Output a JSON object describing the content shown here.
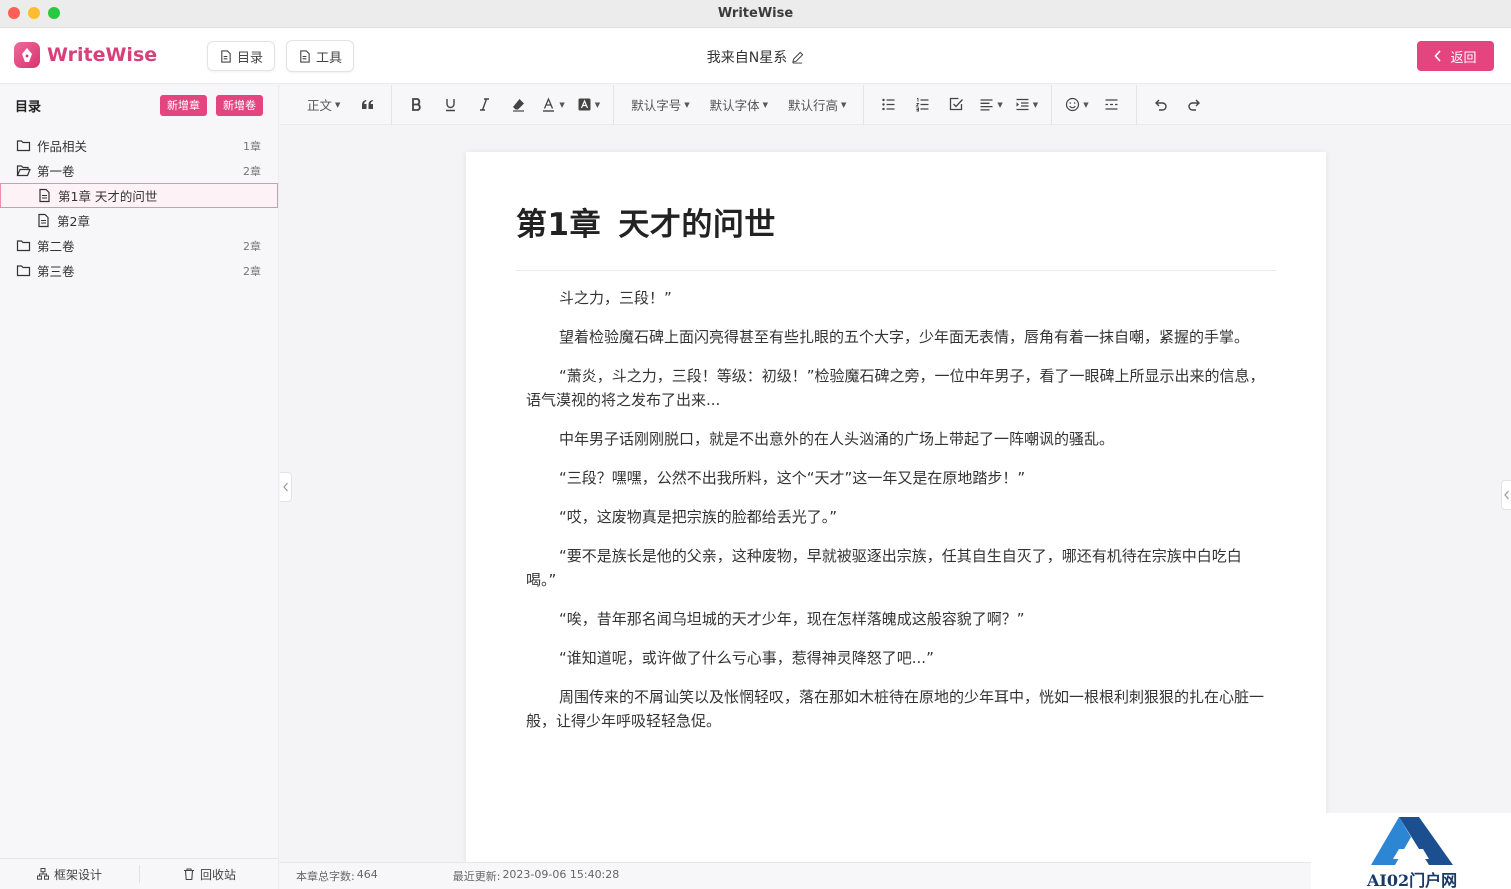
{
  "window": {
    "title": "WriteWise"
  },
  "header": {
    "logo_text": "WriteWise",
    "catalog_btn": "目录",
    "tools_btn": "工具",
    "doc_title": "我来自N星系",
    "back_btn": "返回",
    "accent": "#e5457f"
  },
  "sidebar": {
    "title": "目录",
    "new_chapter": "新增章",
    "new_volume": "新增卷",
    "items": [
      {
        "label": "作品相关",
        "count": "1章",
        "level": 0,
        "icon": "folder-icon"
      },
      {
        "label": "第一卷",
        "count": "2章",
        "level": 0,
        "icon": "folder-open-icon"
      },
      {
        "label": "第1章 天才的问世",
        "count": "",
        "level": 1,
        "icon": "document-icon",
        "active": true
      },
      {
        "label": "第2章",
        "count": "",
        "level": 1,
        "icon": "document-icon"
      },
      {
        "label": "第二卷",
        "count": "2章",
        "level": 0,
        "icon": "folder-icon"
      },
      {
        "label": "第三卷",
        "count": "2章",
        "level": 0,
        "icon": "folder-icon"
      }
    ],
    "footer": {
      "outline": "框架设计",
      "trash": "回收站"
    }
  },
  "toolbar": {
    "paragraph": "正文",
    "font_size": "默认字号",
    "font_family": "默认字体",
    "line_height": "默认行高"
  },
  "editor": {
    "chapter_title": "第1章  天才的问世",
    "paragraphs": [
      "斗之力，三段！”",
      "望着检验魔石碑上面闪亮得甚至有些扎眼的五个大字，少年面无表情，唇角有着一抹自嘲，紧握的手掌。",
      "“萧炎，斗之力，三段！等级：初级！”检验魔石碑之旁，一位中年男子，看了一眼碑上所显示出来的信息，语气漠视的将之发布了出来...",
      "中年男子话刚刚脱口，就是不出意外的在人头汹涌的广场上带起了一阵嘲讽的骚乱。",
      "“三段？嘿嘿，公然不出我所料，这个“天才”这一年又是在原地踏步！”",
      "“哎，这废物真是把宗族的脸都给丢光了。”",
      "“要不是族长是他的父亲，这种废物，早就被驱逐出宗族，任其自生自灭了，哪还有机待在宗族中白吃白喝。”",
      "“唉，昔年那名闻乌坦城的天才少年，现在怎样落魄成这般容貌了啊？”",
      "“谁知道呢，或许做了什么亏心事，惹得神灵降怒了吧...”",
      "周围传来的不屑讪笑以及怅惘轻叹，落在那如木桩待在原地的少年耳中，恍如一根根利刺狠狠的扎在心脏一般，让得少年呼吸轻轻急促。"
    ]
  },
  "status": {
    "word_label": "本章总字数:",
    "word_count": "464",
    "updated_label": "最近更新:",
    "updated_time": "2023-09-06 15:40:28"
  },
  "watermark": {
    "text": "AI02门户网"
  }
}
